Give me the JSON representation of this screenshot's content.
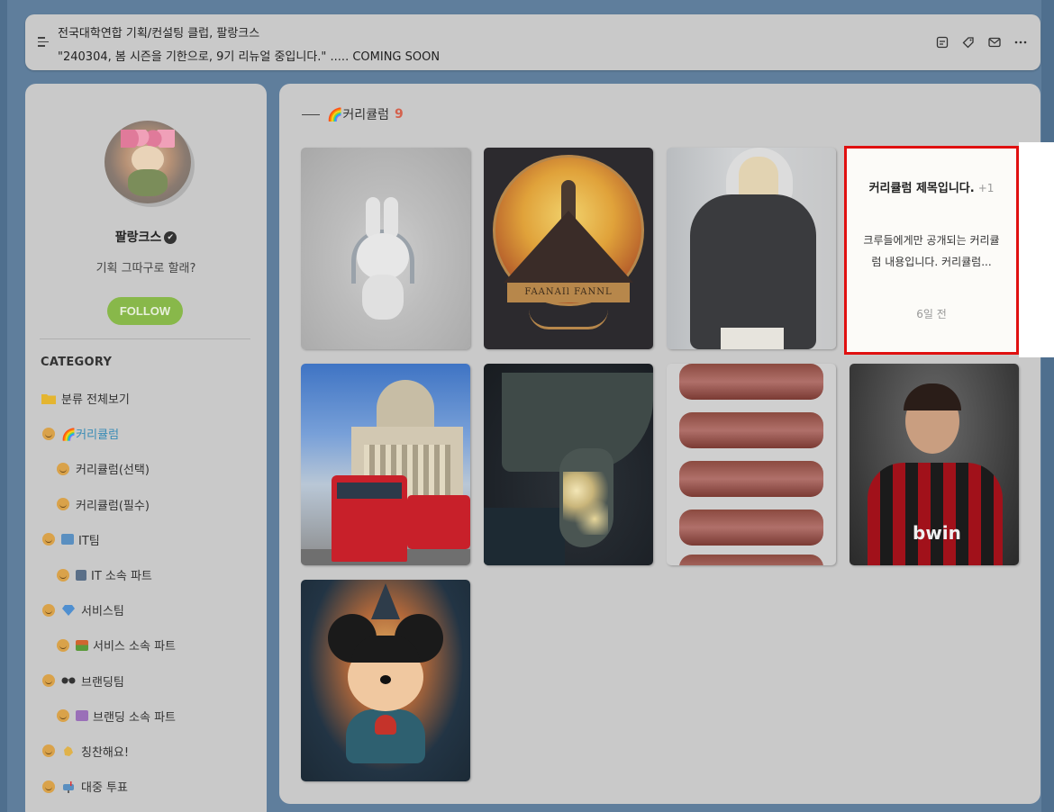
{
  "header": {
    "line1": "전국대학연합 기획/컨설팅 클럽, 팔랑크스",
    "line2": "\"240304, 봄 시즌을 기한으로, 9기 리뉴얼 중입니다.\" ..... COMING SOON",
    "icons": [
      "notebook-icon",
      "tag-icon",
      "mail-icon",
      "more-icon"
    ]
  },
  "profile": {
    "name": "팔랑크스",
    "bio": "기획 그따구로 할래?",
    "follow_label": "FOLLOW"
  },
  "category": {
    "title": "CATEGORY",
    "items": [
      {
        "label": "분류 전체보기",
        "icon": "folder-icon",
        "level": 0,
        "active": false
      },
      {
        "label": "🌈커리큘럼",
        "icon": "smile-icon",
        "level": 0,
        "active": true
      },
      {
        "label": "커리큘럼(선택)",
        "icon": "smile-icon",
        "level": 1,
        "active": false
      },
      {
        "label": "커리큘럼(필수)",
        "icon": "smile-icon",
        "level": 1,
        "active": false
      },
      {
        "label": "IT팀",
        "icon": "smile-icon",
        "level": 0,
        "active": false
      },
      {
        "label": "IT 소속 파트",
        "icon": "smile-icon",
        "level": 1,
        "active": false
      },
      {
        "label": "서비스팀",
        "icon": "smile-icon",
        "level": 0,
        "active": false
      },
      {
        "label": "서비스 소속 파트",
        "icon": "smile-icon",
        "level": 1,
        "active": false
      },
      {
        "label": "브랜딩팀",
        "icon": "smile-icon",
        "level": 0,
        "active": false
      },
      {
        "label": "브랜딩 소속 파트",
        "icon": "smile-icon",
        "level": 1,
        "active": false
      },
      {
        "label": "칭찬해요!",
        "icon": "smile-icon",
        "level": 0,
        "active": false
      },
      {
        "label": "대중 투표",
        "icon": "smile-icon",
        "level": 0,
        "active": false
      }
    ]
  },
  "main": {
    "section_title": "🌈커리큘럼",
    "section_count": "9",
    "posts": [
      {
        "kind": "image",
        "name": "bunny-headphones-image"
      },
      {
        "kind": "image",
        "name": "tower-poster-image",
        "caption": "FAANAIl FANNL"
      },
      {
        "kind": "image",
        "name": "puffer-jacket-image"
      },
      {
        "kind": "text",
        "title": "커리큘럼 제목입니다.",
        "comments": "+1",
        "body": "크루들에게만 공개되는 커리큘럼 내용입니다. 커리큘럼...",
        "time": "6일 전"
      },
      {
        "kind": "image",
        "name": "london-bus-image"
      },
      {
        "kind": "image",
        "name": "korea-night-satellite-image"
      },
      {
        "kind": "image",
        "name": "steak-stack-image"
      },
      {
        "kind": "image",
        "name": "footballer-rain-image",
        "caption": "bwin"
      },
      {
        "kind": "image",
        "name": "mickey-castle-image"
      }
    ]
  },
  "colors": {
    "background": "#5f7e9c",
    "panel": "#c9c9c9",
    "follow": "#88b84a",
    "accent_count": "#d4614d",
    "highlight_border": "#e01010",
    "active_category": "#3a8cb6"
  }
}
